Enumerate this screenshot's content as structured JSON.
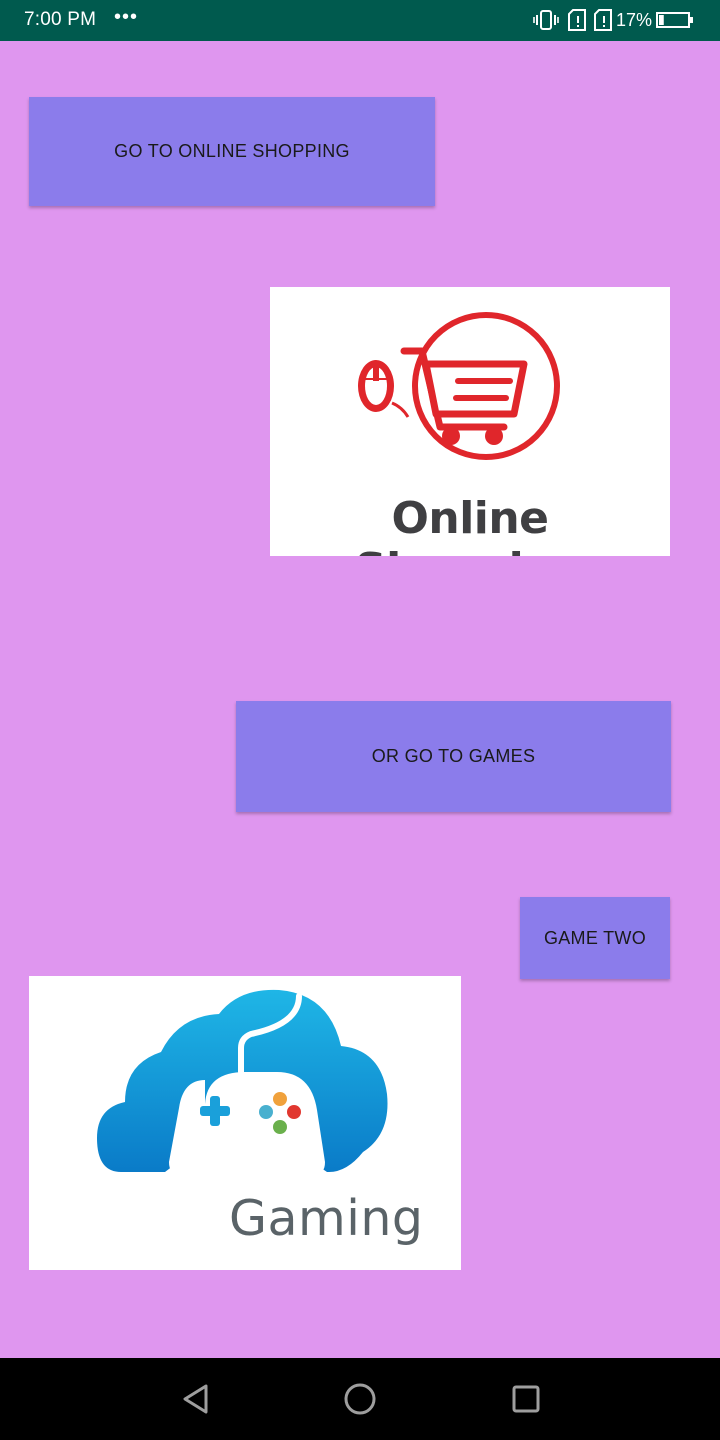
{
  "status_bar": {
    "time": "7:00 PM",
    "overflow_indicator": "•••",
    "battery_percent": "17%",
    "icons": [
      "vibrate-icon",
      "sim-alert-icon",
      "sim-alert-icon",
      "battery-icon"
    ],
    "battery_level": 0.17
  },
  "buttons": {
    "shopping_label": "GO TO ONLINE SHOPPING",
    "games_label": "OR GO TO GAMES",
    "game_two_label": "GAME TWO"
  },
  "images": {
    "shopping_logo_text": "Online Shopping",
    "gaming_logo_text": "Gaming"
  },
  "navigation": {
    "icons": [
      "back-icon",
      "home-icon",
      "recents-icon"
    ]
  },
  "colors": {
    "background": "#df96ef",
    "button": "#8b7ceb",
    "status_bar": "#005a4e",
    "cart_red": "#e0262b"
  }
}
